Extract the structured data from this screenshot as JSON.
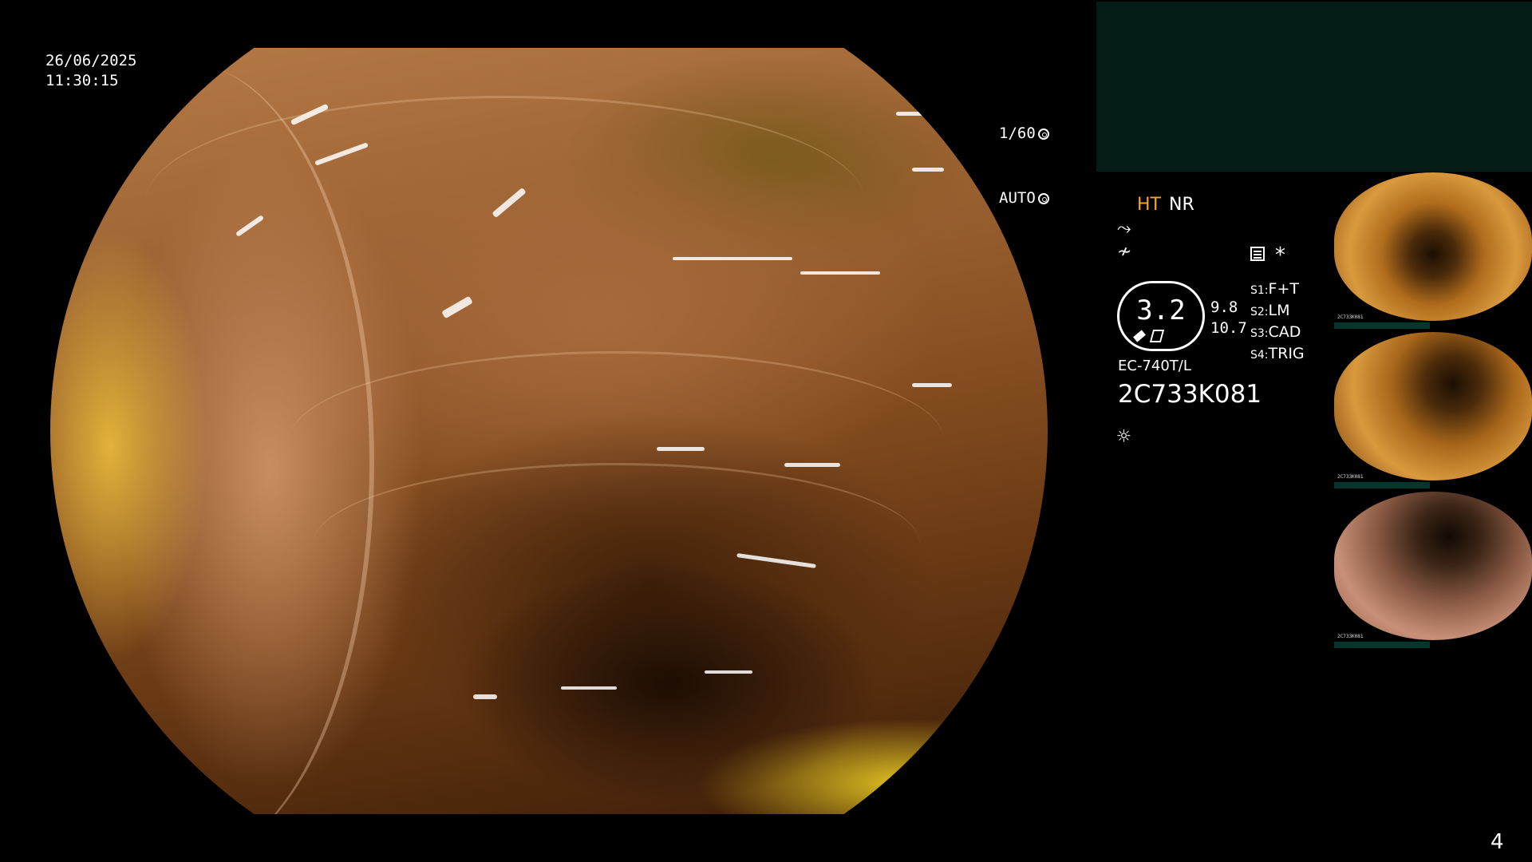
{
  "overlay": {
    "date": "26/06/2025",
    "time": "11:30:15",
    "shutter": "1/60",
    "iris": "AUTO"
  },
  "panel": {
    "ht_label": "HT",
    "nr_label": "NR",
    "gauge_value": "3.2",
    "gauge_top": "9.8",
    "gauge_bottom": "10.7",
    "scope_model": "EC-740T/L",
    "scope_serial": "2C733K081",
    "switches": [
      {
        "key": "S1:",
        "value": "F+T"
      },
      {
        "key": "S2:",
        "value": "LM"
      },
      {
        "key": "S3:",
        "value": "CAD"
      },
      {
        "key": "S4:",
        "value": "TRIG"
      }
    ],
    "asterisk": "*"
  },
  "thumbnails": [
    {
      "label": "2C733K081"
    },
    {
      "label": "2C733K081"
    },
    {
      "label": "2C733K081"
    }
  ],
  "page_number": "4",
  "colors": {
    "ht_accent": "#f2a91a",
    "panel_box": "#041c18",
    "thumb_bar": "#04352c"
  },
  "icons": [
    "shutter-icon",
    "iris-icon",
    "structure-enhance-icon",
    "color-enhance-icon",
    "memo-icon",
    "pen-icon",
    "light-source-icon"
  ]
}
